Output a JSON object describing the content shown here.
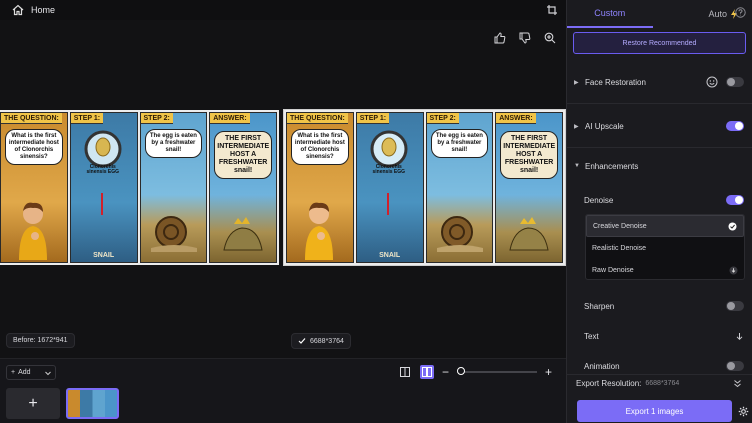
{
  "topbar": {
    "home_label": "Home"
  },
  "comic": {
    "panels": [
      {
        "title": "THE QUESTION:",
        "text": "What is the first intermediate host of Clonorchis sinensis?"
      },
      {
        "title": "STEP 1:",
        "egg_label": "Clonorchis sinensis EGG",
        "bottom_label": "SNAIL"
      },
      {
        "title": "STEP 2:",
        "text": "The egg is eaten by a freshwater snail!"
      },
      {
        "title": "ANSWER:",
        "text": "THE FIRST INTERMEDIATE HOST A FRESHWATER snail!"
      }
    ]
  },
  "tags": {
    "before": "Before: 1672*941",
    "resolution": "6688*3764"
  },
  "bottom": {
    "add_label": "Add",
    "add_tile": "+"
  },
  "zoom": {
    "minus": "−",
    "plus": "+",
    "level": 0
  },
  "panel": {
    "tabs": [
      {
        "label": "Custom"
      },
      {
        "label": "Auto"
      }
    ],
    "restore_label": "Restore Recommended",
    "face_restoration": {
      "label": "Face Restoration",
      "on": false
    },
    "ai_upscale": {
      "label": "AI Upscale",
      "on": true
    },
    "enhancements": {
      "label": "Enhancements"
    },
    "denoise": {
      "label": "Denoise",
      "on": true
    },
    "denoise_options": [
      "Creative Denoise",
      "Realistic Denoise",
      "Raw Denoise"
    ],
    "sharpen": {
      "label": "Sharpen",
      "on": false
    },
    "text": {
      "label": "Text"
    },
    "animation": {
      "label": "Animation",
      "on": false
    },
    "export_resolution": {
      "label": "Export Resolution:",
      "value": "6688*3764"
    },
    "export_button": "Export 1 images"
  },
  "colors": {
    "accent": "#7b6cf6",
    "background": "#0f0f11",
    "panel": "#1b1b1f"
  }
}
